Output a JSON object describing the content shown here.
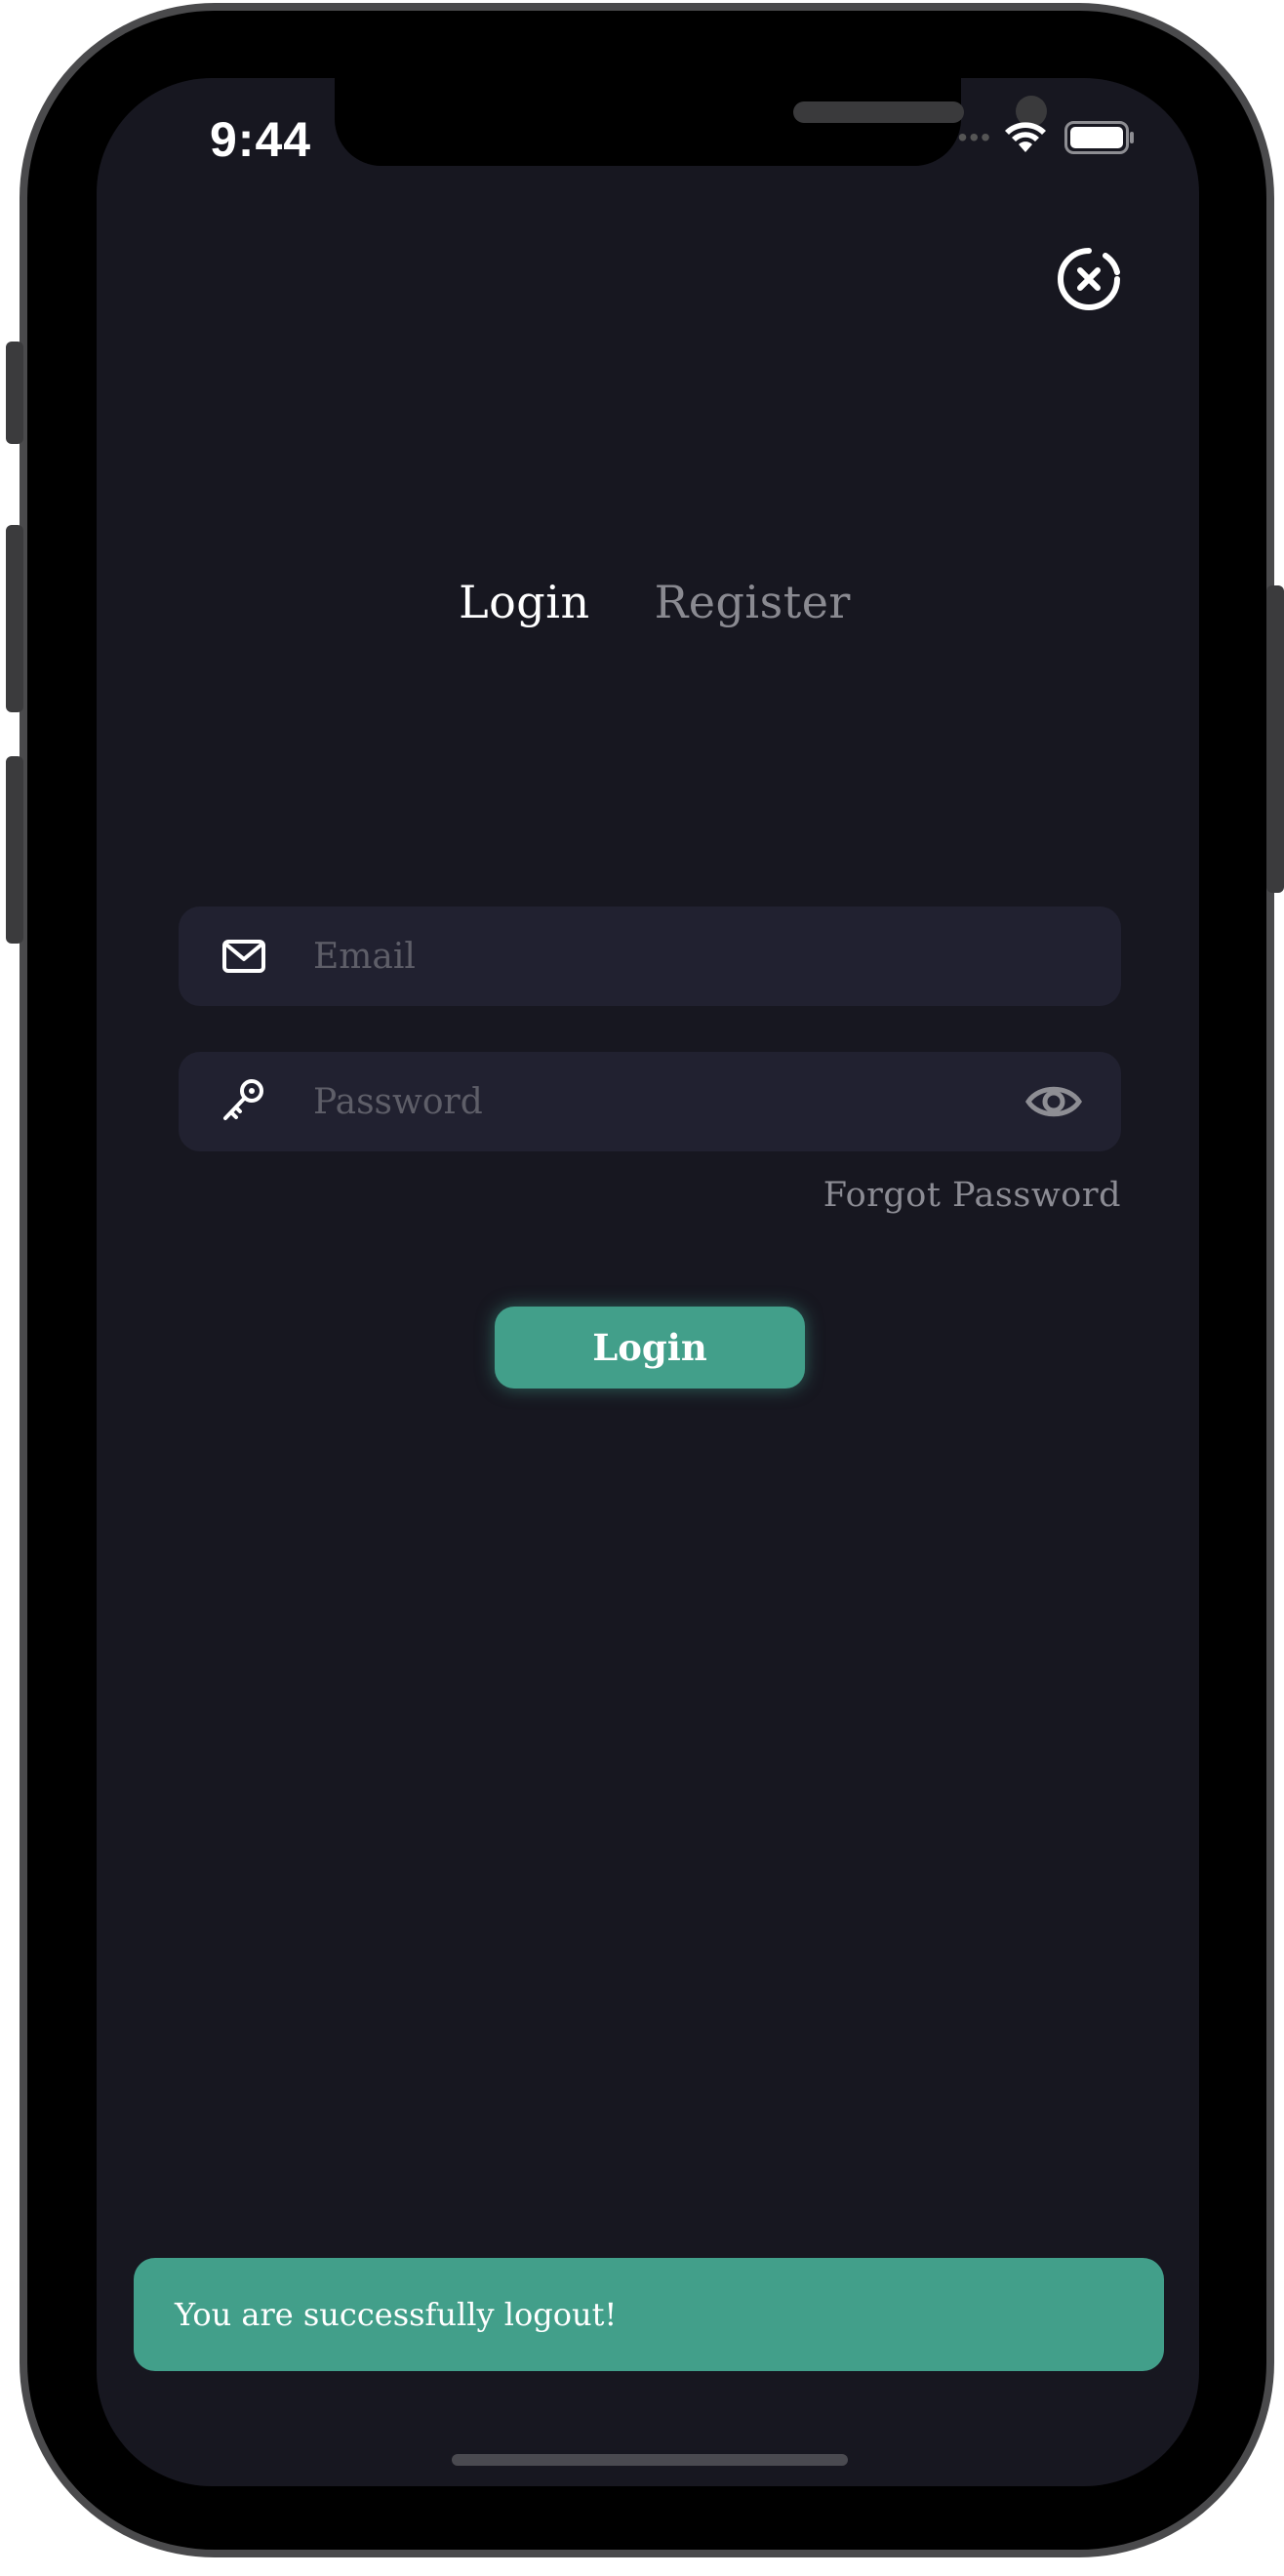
{
  "status_bar": {
    "time": "9:44",
    "signal_icon": "signal-dots-icon",
    "wifi_icon": "wifi-icon",
    "battery_icon": "battery-icon"
  },
  "close_icon": "close-circle-icon",
  "tabs": [
    {
      "label": "Login",
      "active": true
    },
    {
      "label": "Register",
      "active": false
    }
  ],
  "form": {
    "email": {
      "placeholder": "Email",
      "value": "",
      "icon": "mail-icon"
    },
    "password": {
      "placeholder": "Password",
      "value": "",
      "icon": "key-icon",
      "toggle_icon": "eye-icon"
    },
    "forgot_label": "Forgot Password",
    "submit_label": "Login"
  },
  "toast": {
    "message": "You are successfully logout!"
  },
  "colors": {
    "background": "#171720",
    "field": "#212130",
    "accent": "#429f8a",
    "muted_text": "#8a8a91"
  }
}
